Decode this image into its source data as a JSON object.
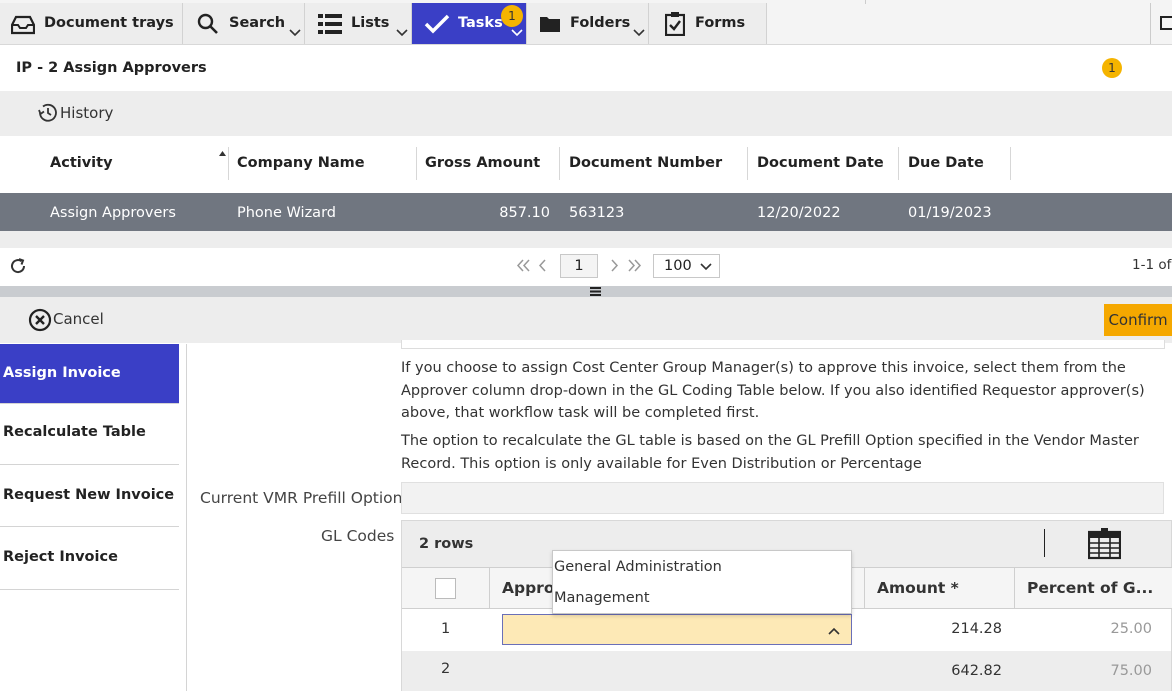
{
  "nav": {
    "tabs": [
      {
        "label": "Document trays",
        "icon": "tray-icon"
      },
      {
        "label": "Search",
        "icon": "search-icon"
      },
      {
        "label": "Lists",
        "icon": "list-icon"
      },
      {
        "label": "Tasks",
        "icon": "checkmark-icon",
        "badge": "1"
      },
      {
        "label": "Folders",
        "icon": "folder-icon"
      },
      {
        "label": "Forms",
        "icon": "clipboard-icon"
      }
    ],
    "accent": "#3a3fc6"
  },
  "task": {
    "title": "IP - 2 Assign Approvers",
    "badge": "1",
    "history_label": "History"
  },
  "grid": {
    "columns": [
      "Activity",
      "Company Name",
      "Gross Amount",
      "Document Number",
      "Document Date",
      "Due Date"
    ],
    "rows": [
      {
        "activity": "Assign Approvers",
        "company": "Phone Wizard",
        "gross": "857.10",
        "doc_number": "563123",
        "doc_date": "12/20/2022",
        "due_date": "01/19/2023"
      }
    ]
  },
  "pager": {
    "page": "1",
    "page_size": "100",
    "summary": "1-1 of"
  },
  "actions": {
    "cancel_label": "Cancel",
    "confirm_label": "Confirm",
    "confirm_color": "#f5a800"
  },
  "side_menu": {
    "items": [
      "Assign Invoice",
      "Recalculate Table",
      "Request New Invoice",
      "Reject Invoice"
    ],
    "active": "Assign Invoice"
  },
  "form": {
    "paragraph1": "If you choose to assign Cost Center Group Manager(s) to approve this invoice, select them from the Approver column drop-down in the GL Coding Table below. If you also identified Requestor approver(s) above, that workflow task will be completed first.",
    "paragraph2": "The option to recalculate the GL table is based on the GL Prefill Option specified in the Vendor Master Record. This option is only available for Even Distribution or Percentage",
    "prefill_label": "Current VMR Prefill Option",
    "prefill_value": "",
    "gl_label": "GL Codes"
  },
  "gl_table": {
    "rows_label": "2 rows",
    "columns": [
      "Appro",
      "Amount *",
      "Percent of G..."
    ],
    "rows": [
      {
        "num": "1",
        "approver": "",
        "amount": "214.28",
        "percent": "25.00"
      },
      {
        "num": "2",
        "approver": "",
        "amount": "642.82",
        "percent": "75.00"
      }
    ],
    "dropdown_options": [
      "General Administration",
      "Management"
    ]
  }
}
